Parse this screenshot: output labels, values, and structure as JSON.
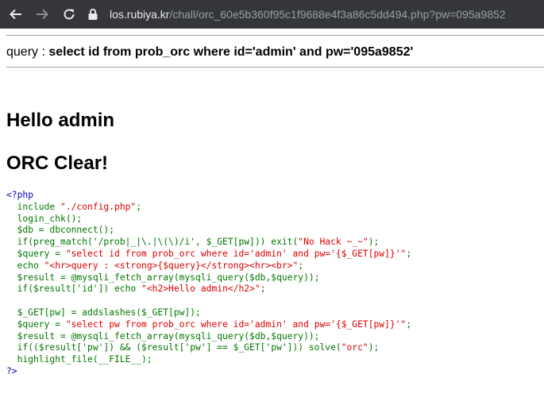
{
  "browser": {
    "url_host": "los.rubiya.kr",
    "url_rest": "/chall/orc_60e5b360f95c1f9688e4f3a86c5dd494.php?pw=095a9852"
  },
  "page": {
    "query_prefix": "query : ",
    "query_text": "select id from prob_orc where id='admin' and pw='095a9852'",
    "hello": "Hello admin",
    "clear": "ORC Clear!"
  },
  "source_code": [
    "<?php",
    "  include \"./config.php\";",
    "  login_chk();",
    "  $db = dbconnect();",
    "  if(preg_match('/prob|_|\\.|\\(\\)/i', $_GET[pw])) exit(\"No Hack ~_~\");",
    "  $query = \"select id from prob_orc where id='admin' and pw='{$_GET[pw]}'\";",
    "  echo \"<hr>query : <strong>{$query}</strong><hr><br>\";",
    "  $result = @mysqli_fetch_array(mysqli_query($db,$query));",
    "  if($result['id']) echo \"<h2>Hello admin</h2>\";",
    "",
    "  $_GET[pw] = addslashes($_GET[pw]);",
    "  $query = \"select pw from prob_orc where id='admin' and pw='{$_GET[pw]}'\";",
    "  $result = @mysqli_fetch_array(mysqli_query($db,$query));",
    "  if(($result['pw']) && ($result['pw'] == $_GET['pw'])) solve(\"orc\");",
    "  highlight_file(__FILE__);",
    "?>"
  ]
}
